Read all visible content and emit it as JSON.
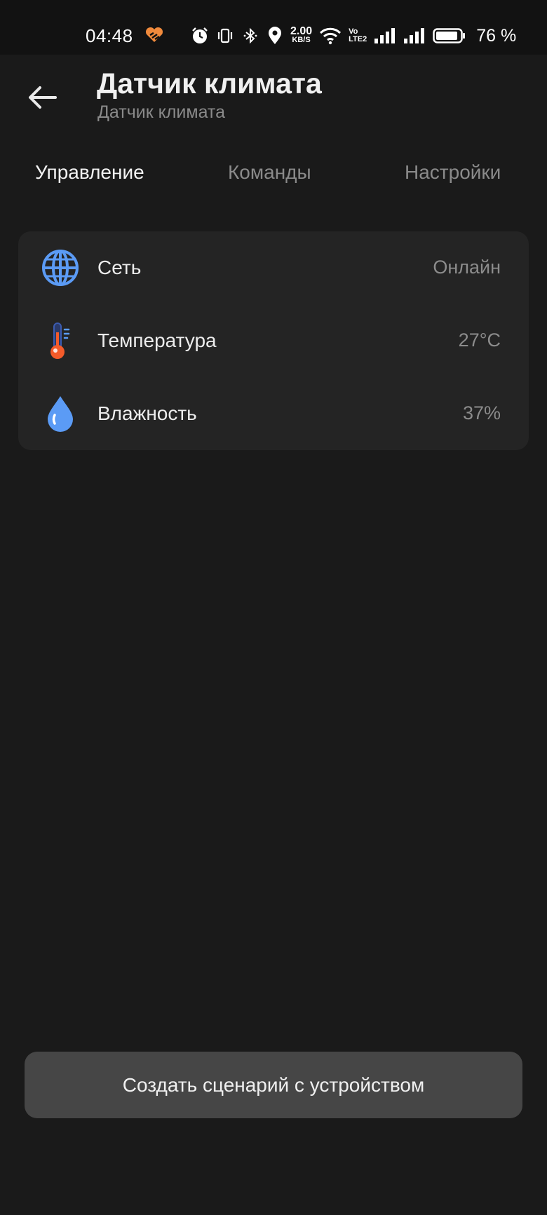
{
  "status_bar": {
    "time": "04:48",
    "net_speed_value": "2.00",
    "net_speed_unit": "KB/S",
    "volte_top": "Vo",
    "volte_bottom": "LTE2",
    "battery_percent": "76 %",
    "icons": [
      "heart-icon",
      "alarm-icon",
      "vibrate-icon",
      "bluetooth-icon",
      "location-icon",
      "wifi-icon",
      "signal-icon",
      "signal-icon",
      "battery-icon"
    ]
  },
  "header": {
    "title": "Датчик климата",
    "subtitle": "Датчик климата"
  },
  "tabs": [
    {
      "label": "Управление",
      "active": true
    },
    {
      "label": "Команды",
      "active": false
    },
    {
      "label": "Настройки",
      "active": false
    }
  ],
  "status_rows": [
    {
      "icon": "globe-icon",
      "label": "Сеть",
      "value": "Онлайн"
    },
    {
      "icon": "thermometer-icon",
      "label": "Температура",
      "value": "27°C"
    },
    {
      "icon": "water-drop-icon",
      "label": "Влажность",
      "value": "37%"
    }
  ],
  "actions": {
    "create_scenario_label": "Создать сценарий с устройством"
  },
  "colors": {
    "background": "#1a1a1a",
    "card": "#242424",
    "button": "#464646",
    "accent_blue": "#5b9bf5",
    "thermo_red": "#f45b2a",
    "heart_orange": "#f08a3c"
  }
}
